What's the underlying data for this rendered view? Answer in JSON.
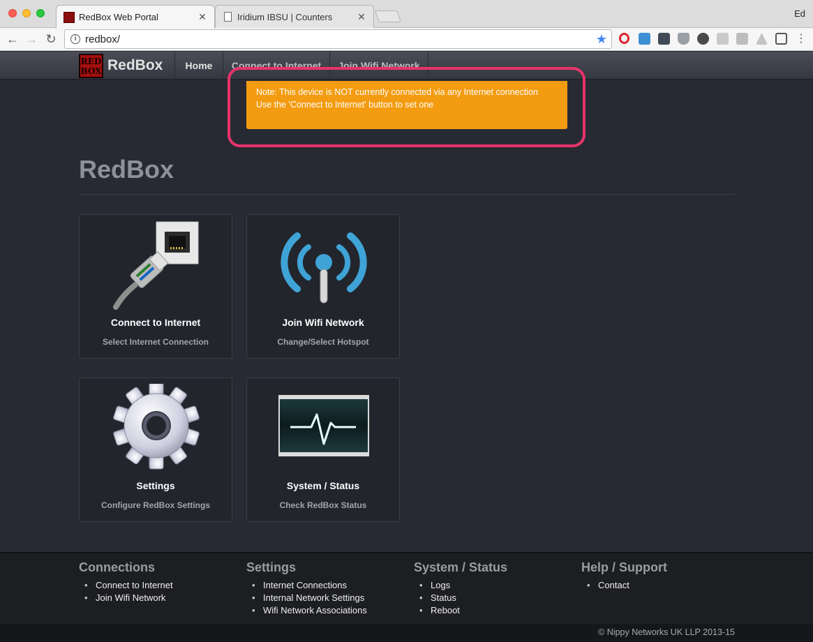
{
  "browser": {
    "tabs": [
      {
        "title": "RedBox Web Portal",
        "active": true
      },
      {
        "title": "Iridium IBSU | Counters",
        "active": false
      }
    ],
    "profile_name": "Ed",
    "url": "redbox/"
  },
  "navbar": {
    "brand_logo_text": "RED BOX",
    "brand": "RedBox",
    "items": [
      "Home",
      "Connect to Internet",
      "Join Wifi Network"
    ]
  },
  "alert": {
    "line1": "Note: This device is NOT currently connected via any Internet connection",
    "line2": "Use the 'Connect to Internet' button to set one"
  },
  "page_title": "RedBox",
  "tiles": [
    {
      "title": "Connect to Internet",
      "subtitle": "Select Internet Connection",
      "icon": "ethernet-cable-icon"
    },
    {
      "title": "Join Wifi Network",
      "subtitle": "Change/Select Hotspot",
      "icon": "wifi-antenna-icon"
    },
    {
      "title": "Settings",
      "subtitle": "Configure RedBox Settings",
      "icon": "gear-icon"
    },
    {
      "title": "System / Status",
      "subtitle": "Check RedBox Status",
      "icon": "heartbeat-monitor-icon"
    }
  ],
  "footer": {
    "columns": [
      {
        "heading": "Connections",
        "links": [
          "Connect to Internet",
          "Join Wifi Network"
        ]
      },
      {
        "heading": "Settings",
        "links": [
          "Internet Connections",
          "Internal Network Settings",
          "Wifi Network Associations"
        ]
      },
      {
        "heading": "System / Status",
        "links": [
          "Logs",
          "Status",
          "Reboot"
        ]
      },
      {
        "heading": "Help / Support",
        "links": [
          "Contact"
        ]
      }
    ],
    "copyright": "© Nippy Networks UK LLP 2013-15"
  },
  "colors": {
    "alert": "#f39c12",
    "highlight": "#e8336b",
    "background": "#272a33"
  }
}
